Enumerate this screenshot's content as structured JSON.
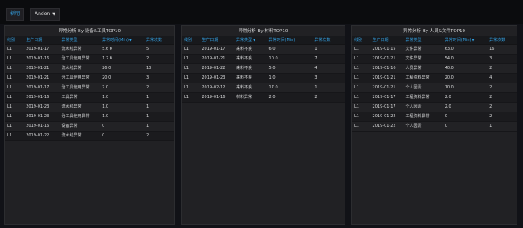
{
  "toolbar": {
    "variable_label": "树明",
    "variable_value": "Andon"
  },
  "panels": [
    {
      "title": "异常分析-By 设备&工具TOP10",
      "columns": [
        "线别",
        "生产日期",
        "异常类型",
        "异常时间(Min)",
        "异常次数"
      ],
      "sorted_column": 3,
      "rows": [
        [
          "L1",
          "2019-01-17",
          "流水线异常",
          "5.6 K",
          "5"
        ],
        [
          "L1",
          "2019-01-16",
          "治工具使用异常",
          "1.2 K",
          "2"
        ],
        [
          "L1",
          "2019-01-21",
          "流水线异常",
          "26.0",
          "13"
        ],
        [
          "L1",
          "2019-01-21",
          "治工具使用异常",
          "20.0",
          "3"
        ],
        [
          "L1",
          "2019-01-17",
          "治工具使用异常",
          "7.0",
          "2"
        ],
        [
          "L1",
          "2019-01-16",
          "工具异常",
          "1.0",
          "1"
        ],
        [
          "L1",
          "2019-01-23",
          "流水线异常",
          "1.0",
          "1"
        ],
        [
          "L1",
          "2019-01-23",
          "治工具使用异常",
          "1.0",
          "1"
        ],
        [
          "L1",
          "2019-01-16",
          "设备异常",
          "0",
          "1"
        ],
        [
          "L1",
          "2019-01-22",
          "流水线异常",
          "0",
          "2"
        ]
      ]
    },
    {
      "title": "异常分析-By 材料TOP10",
      "columns": [
        "线别",
        "生产日期",
        "异常类型",
        "异常时间(Min)",
        "异常次数"
      ],
      "sorted_column": 2,
      "rows": [
        [
          "L1",
          "2019-01-17",
          "来料不良",
          "6.0",
          "1"
        ],
        [
          "L1",
          "2019-01-21",
          "来料不良",
          "10.0",
          "7"
        ],
        [
          "L1",
          "2019-01-22",
          "来料不良",
          "5.0",
          "4"
        ],
        [
          "L1",
          "2019-01-23",
          "来料不良",
          "1.0",
          "3"
        ],
        [
          "L1",
          "2019-02-12",
          "来料不良",
          "17.0",
          "1"
        ],
        [
          "L1",
          "2019-01-16",
          "材料异常",
          "2.0",
          "2"
        ]
      ]
    },
    {
      "title": "异常分析-By 人员&文件TOP10",
      "columns": [
        "线别",
        "生产日期",
        "异常类型",
        "异常时间(Min)",
        "异常次数"
      ],
      "sorted_column": 3,
      "rows": [
        [
          "L1",
          "2019-01-15",
          "文件异常",
          "63.0",
          "16"
        ],
        [
          "L1",
          "2019-01-21",
          "文件异常",
          "54.0",
          "3"
        ],
        [
          "L1",
          "2019-01-16",
          "人员异常",
          "40.0",
          "2"
        ],
        [
          "L1",
          "2019-01-21",
          "工程资料异常",
          "20.0",
          "4"
        ],
        [
          "L1",
          "2019-01-21",
          "个人因素",
          "10.0",
          "2"
        ],
        [
          "L1",
          "2019-01-17",
          "工程资料异常",
          "2.0",
          "2"
        ],
        [
          "L1",
          "2019-01-17",
          "个人因素",
          "2.0",
          "2"
        ],
        [
          "L1",
          "2019-01-22",
          "工程资料异常",
          "0",
          "2"
        ],
        [
          "L1",
          "2019-01-22",
          "个人因素",
          "0",
          "1"
        ]
      ]
    }
  ],
  "colors": {
    "background": "#111217",
    "panel": "#212124",
    "header_text": "#33a2e5",
    "text": "#d8d9da"
  },
  "icons": {
    "variable_dropdown": "caret-down-icon",
    "sort": "caret-down-icon"
  }
}
